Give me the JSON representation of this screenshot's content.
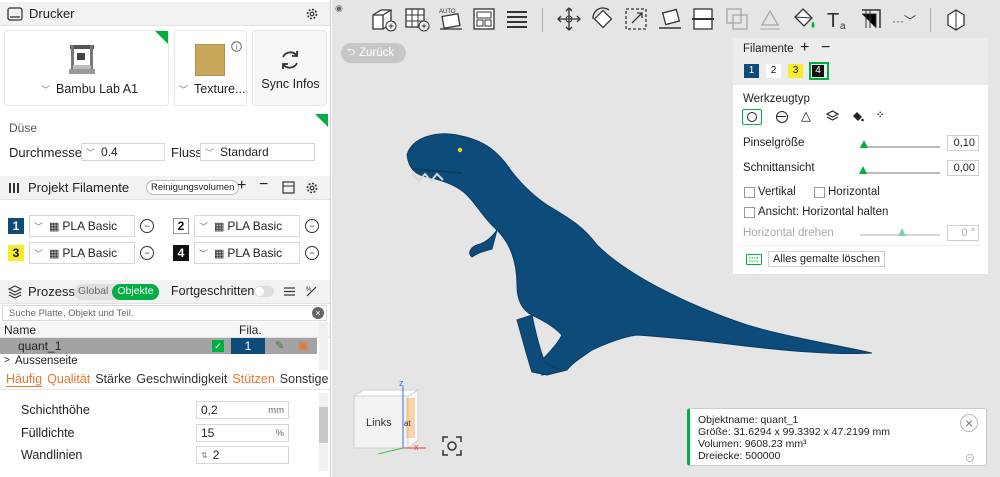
{
  "printer": {
    "section_title": "Drucker",
    "model": "Bambu Lab A1",
    "plate": "Texture...",
    "sync_label": "Sync Infos"
  },
  "nozzle": {
    "label": "Düse",
    "diameter_label": "Durchmesser",
    "diameter_value": "0.4",
    "flow_label": "Fluss",
    "flow_value": "Standard"
  },
  "filaments": {
    "section_title": "Projekt Filamente",
    "purge_button": "Reinigungsvolumen",
    "items": [
      {
        "num": "1",
        "name": "PLA Basic",
        "color": "#0d4b7a",
        "text": "#ffffff"
      },
      {
        "num": "2",
        "name": "PLA Basic",
        "color": "#ffffff",
        "text": "#111111"
      },
      {
        "num": "3",
        "name": "PLA Basic",
        "color": "#f5ec2a",
        "text": "#111111"
      },
      {
        "num": "4",
        "name": "PLA Basic",
        "color": "#111111",
        "text": "#ffffff"
      }
    ]
  },
  "process": {
    "section_title": "Prozess",
    "global_label": "Global",
    "objects_label": "Objekte",
    "advanced_label": "Fortgeschritten",
    "search_placeholder": "Suche Platte, Objekt und Teil.",
    "col_name": "Name",
    "col_fila": "Fila.",
    "object_name": "quant_1",
    "object_fila": "1",
    "part_name": "Aussenseite",
    "tabs": [
      "Häufig",
      "Qualität",
      "Stärke",
      "Geschwindigkeit",
      "Stützen",
      "Sonstige"
    ],
    "settings": [
      {
        "label": "Schichthöhe",
        "value": "0,2",
        "unit": "mm"
      },
      {
        "label": "Fülldichte",
        "value": "15",
        "unit": "%"
      },
      {
        "label": "Wandlinien",
        "value": "2",
        "unit": ""
      }
    ]
  },
  "viewport": {
    "back_label": "Zurück",
    "cube_label": "Links",
    "cube_side": "at",
    "axis_x": "x",
    "axis_z": "z",
    "model_color": "#0d4b7a"
  },
  "paint_panel": {
    "filaments_label": "Filamente",
    "filament_nums": [
      "1",
      "2",
      "3",
      "4"
    ],
    "tooltype_label": "Werkzeugtyp",
    "brush_size_label": "Pinselgröße",
    "brush_size_value": "0,10",
    "section_view_label": "Schnittansicht",
    "section_view_value": "0,00",
    "vertical_label": "Vertikal",
    "horizontal_label": "Horizontal",
    "view_horizontal_label": "Ansicht: Horizontal halten",
    "rotate_horizontal_label": "Horizontal drehen",
    "rotate_value": "0 °",
    "clear_label": "Alles gemalte löschen"
  },
  "object_info": {
    "name_line": "Objektname: quant_1",
    "size_line": "Größe: 31.6294 x 99.3392 x 47.2199 mm",
    "volume_line": "Volumen: 9608.23 mm³",
    "triangles_line": "Dreiecke: 500000"
  },
  "colors": {
    "accent": "#00ae42",
    "orange": "#e8762c"
  }
}
